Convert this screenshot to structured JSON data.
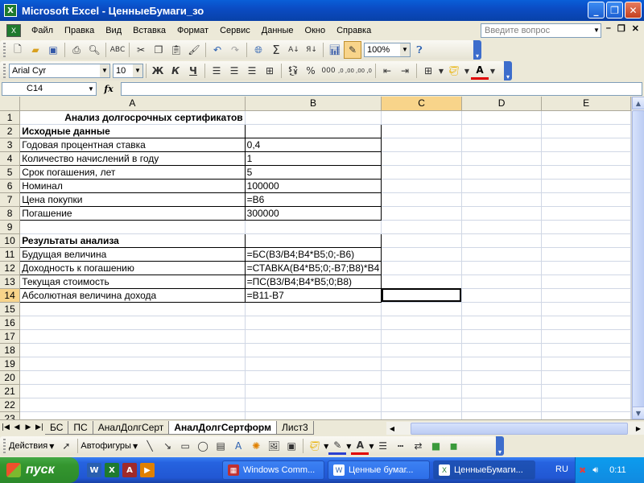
{
  "window": {
    "title": "Microsoft Excel - ЦенныеБумаги_зо",
    "minimize": "_",
    "maximize": "❐",
    "close": "✕"
  },
  "menu": {
    "items": [
      "Файл",
      "Правка",
      "Вид",
      "Вставка",
      "Формат",
      "Сервис",
      "Данные",
      "Окно",
      "Справка"
    ],
    "help_placeholder": "Введите вопрос",
    "mdi_min": "–",
    "mdi_restore": "❐",
    "mdi_close": "✕"
  },
  "toolbar_standard": {
    "zoom": "100%"
  },
  "toolbar_format": {
    "font": "Arial Cyr",
    "size": "10",
    "bold": "Ж",
    "italic": "К",
    "underline": "Ч",
    "percent": "%",
    "thousands": "000",
    "inc_decimal": ",0 ,00",
    "dec_decimal": ",00 ,0"
  },
  "formula_bar": {
    "cell_ref": "C14",
    "fx": "fx",
    "content": ""
  },
  "grid": {
    "columns": [
      "",
      "A",
      "B",
      "C",
      "D",
      "E"
    ],
    "selected_column": "C",
    "selected_row": 14,
    "rows": [
      {
        "n": "1",
        "a": "Анализ долгосрочных сертификатов",
        "b": ""
      },
      {
        "n": "2",
        "a": "Исходные данные",
        "b": ""
      },
      {
        "n": "3",
        "a": "Годовая процентная ставка",
        "b": "0,4"
      },
      {
        "n": "4",
        "a": "Количество начислений в году",
        "b": "1"
      },
      {
        "n": "5",
        "a": "Срок погашения, лет",
        "b": "5"
      },
      {
        "n": "6",
        "a": "Номинал",
        "b": "100000"
      },
      {
        "n": "7",
        "a": "Цена покупки",
        "b": "=B6"
      },
      {
        "n": "8",
        "a": "Погашение",
        "b": "300000"
      },
      {
        "n": "9",
        "a": "",
        "b": ""
      },
      {
        "n": "10",
        "a": "Результаты анализа",
        "b": ""
      },
      {
        "n": "11",
        "a": "Будущая величина",
        "b": "=БС(B3/B4;B4*B5;0;-B6)"
      },
      {
        "n": "12",
        "a": "Доходность к погашению",
        "b": "=СТАВКА(B4*B5;0;-B7;B8)*B4"
      },
      {
        "n": "13",
        "a": "Текущая стоимость",
        "b": "=ПС(B3/B4;B4*B5;0;B8)"
      },
      {
        "n": "14",
        "a": "Абсолютная величина дохода",
        "b": "=B11-B7"
      },
      {
        "n": "15",
        "a": "",
        "b": ""
      },
      {
        "n": "16",
        "a": "",
        "b": ""
      },
      {
        "n": "17",
        "a": "",
        "b": ""
      },
      {
        "n": "18",
        "a": "",
        "b": ""
      },
      {
        "n": "19",
        "a": "",
        "b": ""
      },
      {
        "n": "20",
        "a": "",
        "b": ""
      },
      {
        "n": "21",
        "a": "",
        "b": ""
      },
      {
        "n": "22",
        "a": "",
        "b": ""
      },
      {
        "n": "23",
        "a": "",
        "b": ""
      }
    ]
  },
  "sheets": {
    "tabs": [
      "БС",
      "ПС",
      "АналДолгСерт",
      "АналДолгСертформ",
      "Лист3"
    ],
    "active": "АналДолгСертформ"
  },
  "drawing_toolbar": {
    "actions": "Действия",
    "autoshapes": "Автофигуры"
  },
  "taskbar": {
    "start": "пуск",
    "tasks": [
      "Windows Comm...",
      "Ценные бумаг...",
      "ЦенныеБумаги..."
    ],
    "language": "RU",
    "clock": "0:11"
  },
  "colors": {
    "title_blue": "#0B4CC4",
    "selected_header": "#F8D48A",
    "grid_line": "#D0D7E5",
    "taskbar_blue": "#2157D3",
    "start_green": "#34962F"
  }
}
